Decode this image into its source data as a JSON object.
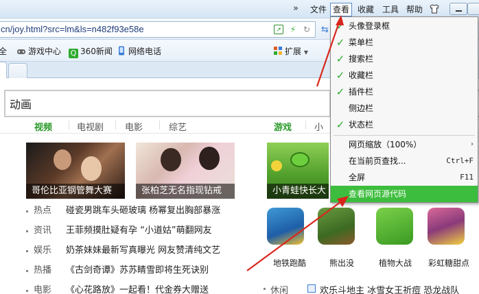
{
  "menubar": {
    "chevron": "»",
    "items": [
      "文件",
      "查看",
      "收藏",
      "工具",
      "帮助"
    ]
  },
  "address": {
    "url": "cn/joy.html?src=lm&ls=n482f93e58e"
  },
  "bookmarks": {
    "all": "全",
    "game": "游戏中心",
    "news": "360新闻",
    "phone": "网络电话",
    "extensions": "扩展"
  },
  "page": {
    "search_value": "动画",
    "categories": [
      "视频",
      "电视剧",
      "电影",
      "综艺",
      "游戏",
      "小"
    ],
    "thumbs": [
      "哥伦比亚钢管舞大赛",
      "张柏芝无名指现钻戒",
      "小青蛙快长大"
    ],
    "news": [
      {
        "tag": "热点",
        "title": "碰瓷男跳车头砸玻璃 杨幂复出胸部暴涨"
      },
      {
        "tag": "资讯",
        "title": "王菲频摸肚疑有孕 “小道姑”萌翻网友"
      },
      {
        "tag": "娱乐",
        "title": "奶茶妹妹最新写真曝光 网友赞清纯文艺"
      },
      {
        "tag": "热播",
        "title": "《古剑奇谭》苏苏睛雪即将生死诀别"
      },
      {
        "tag": "电影",
        "title": "《心花路放》一起看！代金券大赠送"
      }
    ],
    "apps": [
      "地铁跑酷",
      "熊出没",
      "植物大战",
      "彩虹糖甜点"
    ],
    "bottom": {
      "tag": "休闲",
      "title": "欢乐斗地主 冰雪女王祈痘 恐龙战队"
    }
  },
  "view_menu": {
    "items": [
      {
        "label": "头像登录框",
        "checked": true
      },
      {
        "label": "菜单栏",
        "checked": true
      },
      {
        "label": "搜索栏",
        "checked": true
      },
      {
        "label": "收藏栏",
        "checked": true
      },
      {
        "label": "插件栏",
        "checked": true
      },
      {
        "label": "侧边栏",
        "checked": false
      },
      {
        "label": "状态栏",
        "checked": true
      }
    ],
    "zoom": {
      "label": "网页缩放（100%）",
      "arrow": "›"
    },
    "find": {
      "label": "在当前页查找...",
      "shortcut": "Ctrl+F"
    },
    "fullscreen": {
      "label": "全屏",
      "shortcut": "F11"
    },
    "source": {
      "label": "查看网页源代码"
    }
  },
  "colors": {
    "accent_green": "#3dbd3d",
    "check_green": "#2eaa2e",
    "arrow_red": "#d9261c",
    "url_blue": "#1f3c7a"
  }
}
